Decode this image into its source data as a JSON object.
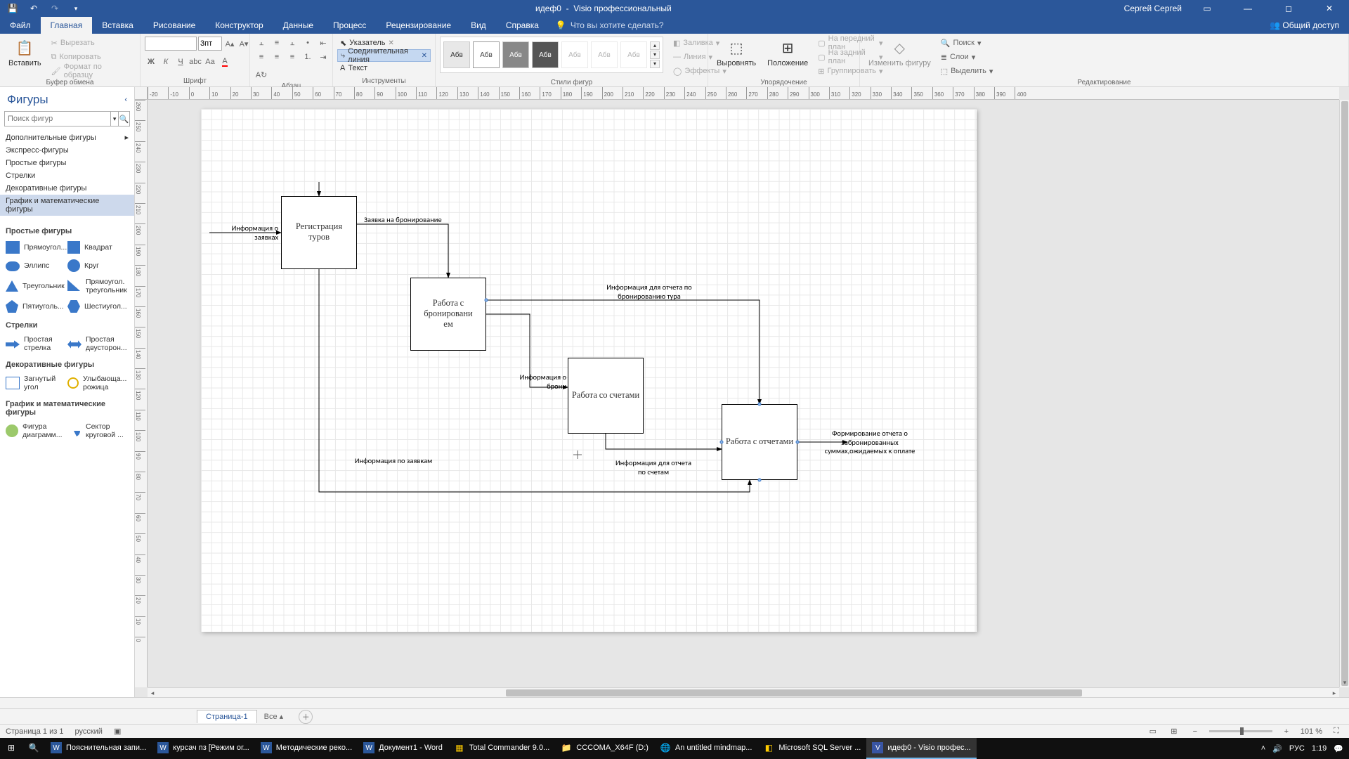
{
  "titlebar": {
    "doc": "идеф0",
    "app": "Visio профессиональный",
    "user": "Сергей Сергей"
  },
  "tabs": {
    "file": "Файл",
    "home": "Главная",
    "insert": "Вставка",
    "draw": "Рисование",
    "design": "Конструктор",
    "data": "Данные",
    "process": "Процесс",
    "review": "Рецензирование",
    "view": "Вид",
    "help": "Справка",
    "tellme": "Что вы хотите сделать?",
    "share": "Общий доступ"
  },
  "ribbon": {
    "clipboard": {
      "paste": "Вставить",
      "cut": "Вырезать",
      "copy": "Копировать",
      "format": "Формат по образцу",
      "label": "Буфер обмена"
    },
    "font": {
      "size": "3пт",
      "label": "Шрифт"
    },
    "para": {
      "label": "Абзац"
    },
    "tools": {
      "pointer": "Указатель",
      "connector": "Соединительная линия",
      "text": "Текст",
      "label": "Инструменты"
    },
    "styles": {
      "sample": "Абв",
      "fill": "Заливка",
      "line": "Линия",
      "effects": "Эффекты",
      "label": "Стили фигур"
    },
    "arrange": {
      "align": "Выровнять",
      "position": "Положение",
      "front": "На передний план",
      "back": "На задний план",
      "group": "Группировать",
      "label": "Упорядочение"
    },
    "edit": {
      "change": "Изменить фигуру",
      "find": "Поиск",
      "layers": "Слои",
      "select": "Выделить",
      "label": "Редактирование"
    }
  },
  "shapes": {
    "title": "Фигуры",
    "placeholder": "Поиск фигур",
    "more": "Дополнительные фигуры",
    "stencils": [
      "Экспресс-фигуры",
      "Простые фигуры",
      "Стрелки",
      "Декоративные фигуры",
      "График и математические фигуры"
    ],
    "sec_simple": "Простые фигуры",
    "s_rect": "Прямоугол...",
    "s_square": "Квадрат",
    "s_ellipse": "Эллипс",
    "s_circle": "Круг",
    "s_tri": "Треугольник",
    "s_rtri": "Прямоугол. треугольник",
    "s_pent": "Пятиуголь...",
    "s_hex": "Шестиугол...",
    "sec_arrows": "Стрелки",
    "s_arrow": "Простая стрелка",
    "s_darrow": "Простая двусторон...",
    "sec_dec": "Декоративные фигуры",
    "s_fold": "Загнутый угол",
    "s_smile": "Улыбающа... рожица",
    "sec_math": "График и математические фигуры",
    "s_chart": "Фигура диаграмм...",
    "s_pie": "Сектор круговой ..."
  },
  "diagram": {
    "b1": "Регистрация туров",
    "b2": "Работа с бронировани\nем",
    "b3": "Работа со счетами",
    "b4": "Работа с отчетами",
    "t_in": "Информация о\nзаявках",
    "t_a12": "Заявка на бронирование",
    "t_rep": "Информация для отчета по\nбронированию тура",
    "t_a23": "Информация о\nброни",
    "t_bot": "Информация по заявкам",
    "t_acc": "Информация для отчета\nпо счетам",
    "t_out": "Формирование отчета о\nзабронированных\nсуммах,ожидаемых к оплате"
  },
  "pagetabs": {
    "p1": "Страница-1",
    "all": "Все",
    "add": "+"
  },
  "status": {
    "pages": "Страница 1 из 1",
    "lang": "русский",
    "zoom": "101 %"
  },
  "taskbar": {
    "items": [
      "Пояснительная запи...",
      "курсач пз [Режим ог...",
      "Методические реко...",
      "Документ1 - Word",
      "Total Commander 9.0...",
      "CCCOMA_X64F (D:)",
      "An untitled mindmap...",
      "Microsoft SQL Server ...",
      "идеф0 - Visio профес..."
    ],
    "lang": "РУС",
    "time": "1:19"
  }
}
